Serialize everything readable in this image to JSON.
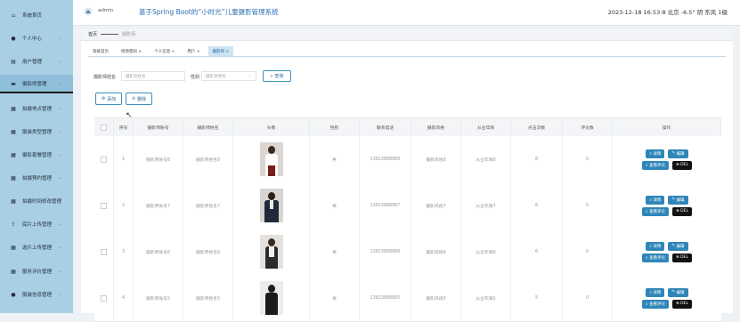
{
  "sidebar": {
    "items": [
      {
        "label": "系统首页",
        "icon": "home-icon",
        "glyph": "⌂"
      },
      {
        "label": "个人中心",
        "icon": "user-icon",
        "glyph": "●"
      },
      {
        "label": "用户管理",
        "icon": "users-icon",
        "glyph": "▤"
      },
      {
        "label": "摄影师管理",
        "icon": "camera-icon",
        "glyph": "▬"
      },
      {
        "label": "拍摄地点管理",
        "icon": "grid-icon",
        "glyph": "▦"
      },
      {
        "label": "服装类型管理",
        "icon": "grid-icon",
        "glyph": "▦"
      },
      {
        "label": "摄影套餐管理",
        "icon": "grid-icon",
        "glyph": "▦"
      },
      {
        "label": "拍摄预约管理",
        "icon": "grid-icon",
        "glyph": "▦"
      },
      {
        "label": "拍摄时间修改管理",
        "icon": "grid-icon",
        "glyph": "▦"
      },
      {
        "label": "底片上传管理",
        "icon": "upload-icon",
        "glyph": "⇪"
      },
      {
        "label": "选片上传管理",
        "icon": "grid-icon",
        "glyph": "▦"
      },
      {
        "label": "服务评价管理",
        "icon": "grid-icon",
        "glyph": "▦"
      },
      {
        "label": "服装信息管理",
        "icon": "user-icon",
        "glyph": "●"
      }
    ]
  },
  "header": {
    "admin": "admin",
    "title": "基于Spring Boot的“小时光”儿童摄影管理系统",
    "status": "2023-12-18 16:53:8    北京 -6.5° 阴 东风 1级"
  },
  "breadcrumb": {
    "home": "首页",
    "current": "摄影师"
  },
  "tabs": [
    "系统首页",
    "修改密码 ×",
    "个人信息 ×",
    "用户 ×",
    "摄影师 ×"
  ],
  "search": {
    "name_label": "摄影师姓名",
    "name_placeholder": "摄影师姓名",
    "gender_label": "性别",
    "gender_placeholder": "摄影师性别",
    "query": "查询"
  },
  "actions": {
    "add": "添加",
    "delete": "删除"
  },
  "table": {
    "headers": [
      "",
      "序号",
      "摄影师账号",
      "摄影师姓名",
      "头像",
      "性别",
      "联系电话",
      "摄影风格",
      "从业年限",
      "点击次数",
      "评论数",
      "操作"
    ],
    "rows": [
      {
        "index": "1",
        "account": "摄影师账号8",
        "name": "摄影师姓名8",
        "gender": "男",
        "phone": "13823888888",
        "style": "摄影风格8",
        "years": "从业年限8",
        "clicks": "8",
        "comments": "0"
      },
      {
        "index": "2",
        "account": "摄影师账号7",
        "name": "摄影师姓名7",
        "gender": "男",
        "phone": "13823888887",
        "style": "摄影风格7",
        "years": "从业年限7",
        "clicks": "8",
        "comments": "0"
      },
      {
        "index": "3",
        "account": "摄影师账号6",
        "name": "摄影师姓名6",
        "gender": "男",
        "phone": "13823888886",
        "style": "摄影风格6",
        "years": "从业年限6",
        "clicks": "6",
        "comments": "0"
      },
      {
        "index": "4",
        "account": "摄影师账号5",
        "name": "摄影师姓名5",
        "gender": "男",
        "phone": "13823888885",
        "style": "摄影风格5",
        "years": "从业年限5",
        "clicks": "5",
        "comments": "0"
      }
    ],
    "ops": {
      "detail": "详情",
      "edit": "编辑",
      "review": "查看评论",
      "del": "DEL"
    }
  },
  "colors": {
    "sidebar": "#a9cfe4",
    "accent": "#2f86b8",
    "title": "#2a6fb0"
  }
}
